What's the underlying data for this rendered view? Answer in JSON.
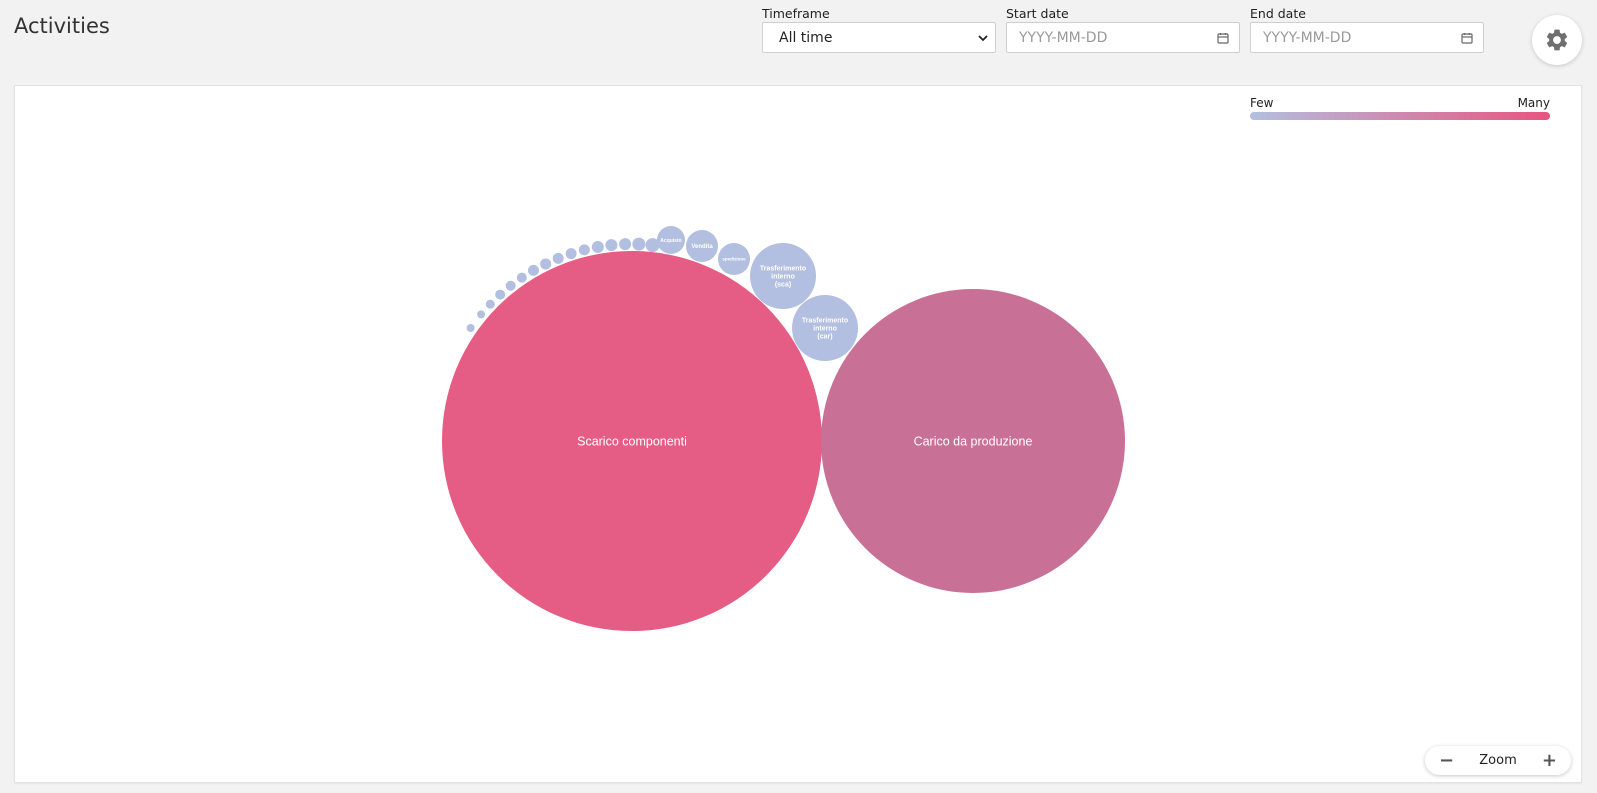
{
  "header": {
    "title": "Activities"
  },
  "filters": {
    "timeframe": {
      "label": "Timeframe",
      "value": "All time"
    },
    "start_date": {
      "label": "Start date",
      "placeholder": "YYYY-MM-DD"
    },
    "end_date": {
      "label": "End date",
      "placeholder": "YYYY-MM-DD"
    }
  },
  "settings": {
    "icon": "gear-icon"
  },
  "legend": {
    "few": "Few",
    "many": "Many",
    "color_low": "#b3bfe0",
    "color_high": "#e8547f"
  },
  "zoom": {
    "label": "Zoom",
    "minus": "−",
    "plus": "+"
  },
  "chart_data": {
    "type": "bubble",
    "bubbles": [
      {
        "label": "Scarico componenti",
        "tier": "many",
        "color": "#e55c84"
      },
      {
        "label": "Carico da produzione",
        "tier": "many",
        "color": "#c97096"
      },
      {
        "label": "Trasferimento interno (sca)",
        "tier": "few",
        "color": "#b3bfe0"
      },
      {
        "label": "Trasferimento interno (car)",
        "tier": "few",
        "color": "#b3bfe0"
      },
      {
        "label": "spedizione",
        "tier": "few",
        "color": "#b3bfe0"
      },
      {
        "label": "Vendita",
        "tier": "few",
        "color": "#b3bfe0"
      },
      {
        "label": "Acquisto",
        "tier": "few",
        "color": "#b3bfe0"
      }
    ]
  }
}
